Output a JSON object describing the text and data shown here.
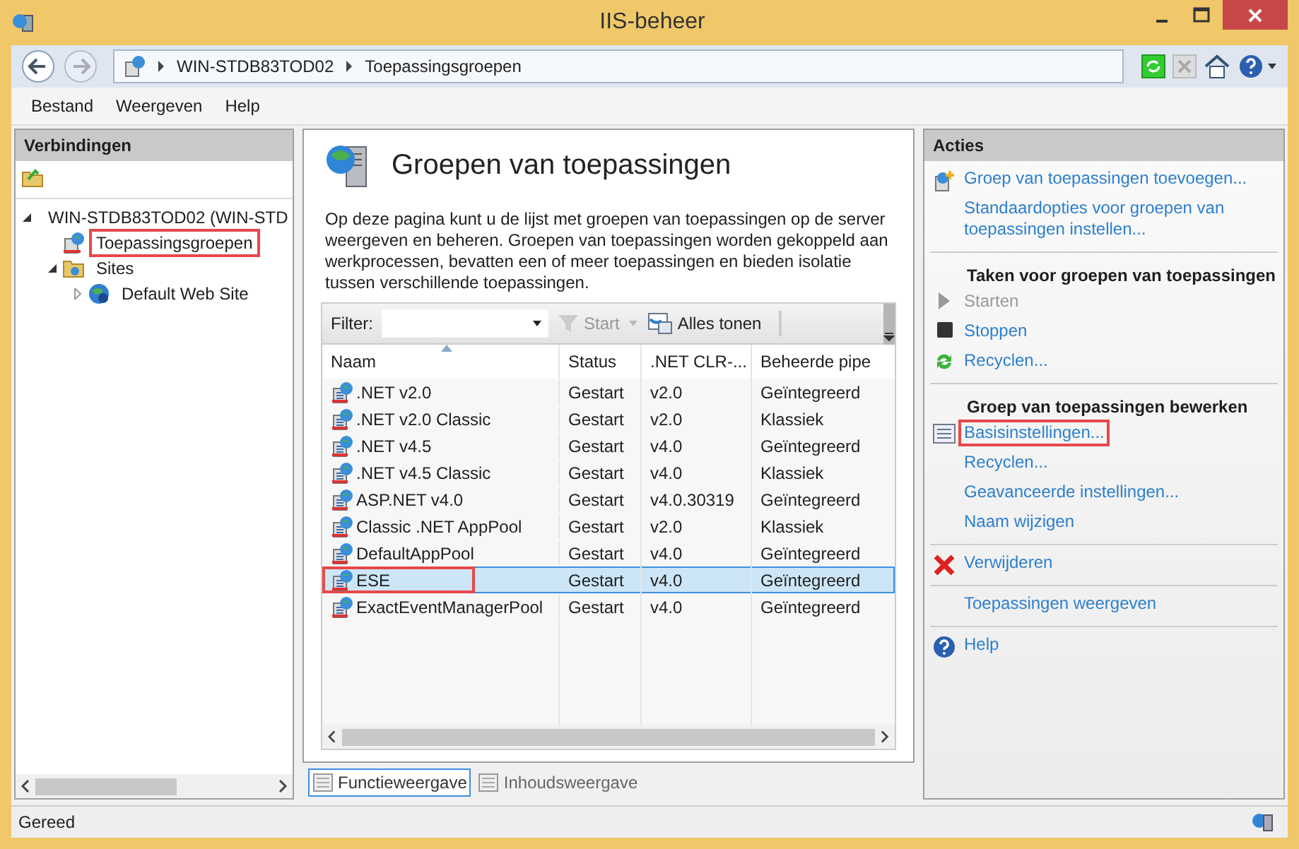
{
  "window": {
    "title": "IIS-beheer"
  },
  "address": {
    "segments": [
      "WIN-STDB83TOD02",
      "Toepassingsgroepen"
    ]
  },
  "menu": [
    "Bestand",
    "Weergeven",
    "Help"
  ],
  "connections": {
    "title": "Verbindingen",
    "tree": [
      {
        "label": "WIN-STDB83TOD02 (WIN-STD",
        "kind": "server",
        "expanded": true,
        "highlighted": false,
        "children": [
          {
            "label": "Toepassingsgroepen",
            "kind": "pools",
            "highlighted": true
          },
          {
            "label": "Sites",
            "kind": "folder",
            "expanded": true,
            "highlighted": false,
            "children": [
              {
                "label": "Default Web Site",
                "kind": "site",
                "expanded": false,
                "highlighted": false
              }
            ]
          }
        ]
      }
    ]
  },
  "content": {
    "title": "Groepen van toepassingen",
    "description": "Op deze pagina kunt u de lijst met groepen van toepassingen op de server weergeven en beheren. Groepen van toepassingen worden gekoppeld aan werkprocessen, bevatten een of meer toepassingen en bieden isolatie tussen verschillende toepassingen.",
    "filter_label": "Filter:",
    "start_button": "Start",
    "show_all_button": "Alles tonen",
    "table": {
      "columns": [
        {
          "label": "Naam",
          "sorted": true
        },
        {
          "label": "Status",
          "sorted": false
        },
        {
          "label": ".NET CLR-...",
          "sorted": false
        },
        {
          "label": "Beheerde pipe",
          "sorted": false
        }
      ],
      "rows": [
        {
          "cells": [
            ".NET v2.0",
            "Gestart",
            "v2.0",
            "Geïntegreerd"
          ],
          "selected": false,
          "highlighted": false
        },
        {
          "cells": [
            ".NET v2.0 Classic",
            "Gestart",
            "v2.0",
            "Klassiek"
          ],
          "selected": false,
          "highlighted": false
        },
        {
          "cells": [
            ".NET v4.5",
            "Gestart",
            "v4.0",
            "Geïntegreerd"
          ],
          "selected": false,
          "highlighted": false
        },
        {
          "cells": [
            ".NET v4.5 Classic",
            "Gestart",
            "v4.0",
            "Klassiek"
          ],
          "selected": false,
          "highlighted": false
        },
        {
          "cells": [
            "ASP.NET v4.0",
            "Gestart",
            "v4.0.30319",
            "Geïntegreerd"
          ],
          "selected": false,
          "highlighted": false
        },
        {
          "cells": [
            "Classic .NET AppPool",
            "Gestart",
            "v2.0",
            "Klassiek"
          ],
          "selected": false,
          "highlighted": false
        },
        {
          "cells": [
            "DefaultAppPool",
            "Gestart",
            "v4.0",
            "Geïntegreerd"
          ],
          "selected": false,
          "highlighted": false
        },
        {
          "cells": [
            "ESE",
            "Gestart",
            "v4.0",
            "Geïntegreerd"
          ],
          "selected": true,
          "highlighted": true
        },
        {
          "cells": [
            "ExactEventManagerPool",
            "Gestart",
            "v4.0",
            "Geïntegreerd"
          ],
          "selected": false,
          "highlighted": false
        }
      ]
    },
    "views": [
      {
        "label": "Functieweergave",
        "selected": true
      },
      {
        "label": "Inhoudsweergave",
        "selected": false
      }
    ]
  },
  "actions": {
    "title": "Acties",
    "groups": [
      [
        {
          "kind": "link",
          "label": "Groep van toepassingen toevoegen...",
          "disabled": false,
          "highlighted": false
        },
        {
          "kind": "link",
          "label": "Standaardopties voor groepen van toepassingen instellen...",
          "disabled": false,
          "highlighted": false
        }
      ],
      [
        {
          "kind": "heading",
          "label": "Taken voor groepen van toepassingen"
        },
        {
          "kind": "link",
          "label": "Starten",
          "disabled": true,
          "highlighted": false
        },
        {
          "kind": "link",
          "label": "Stoppen",
          "disabled": false,
          "highlighted": false
        },
        {
          "kind": "link",
          "label": "Recyclen...",
          "disabled": false,
          "highlighted": false
        }
      ],
      [
        {
          "kind": "heading",
          "label": "Groep van toepassingen bewerken"
        },
        {
          "kind": "link",
          "label": "Basisinstellingen...",
          "disabled": false,
          "highlighted": true
        },
        {
          "kind": "link",
          "label": "Recyclen...",
          "disabled": false,
          "highlighted": false
        },
        {
          "kind": "link",
          "label": "Geavanceerde instellingen...",
          "disabled": false,
          "highlighted": false
        },
        {
          "kind": "link",
          "label": "Naam wijzigen",
          "disabled": false,
          "highlighted": false
        }
      ],
      [
        {
          "kind": "link",
          "label": "Verwijderen",
          "disabled": false,
          "highlighted": false
        }
      ],
      [
        {
          "kind": "link",
          "label": "Toepassingen weergeven",
          "disabled": false,
          "highlighted": false
        }
      ],
      [
        {
          "kind": "link",
          "label": "Help",
          "disabled": false,
          "highlighted": false
        }
      ]
    ]
  },
  "status_bar": {
    "text": "Gereed"
  }
}
